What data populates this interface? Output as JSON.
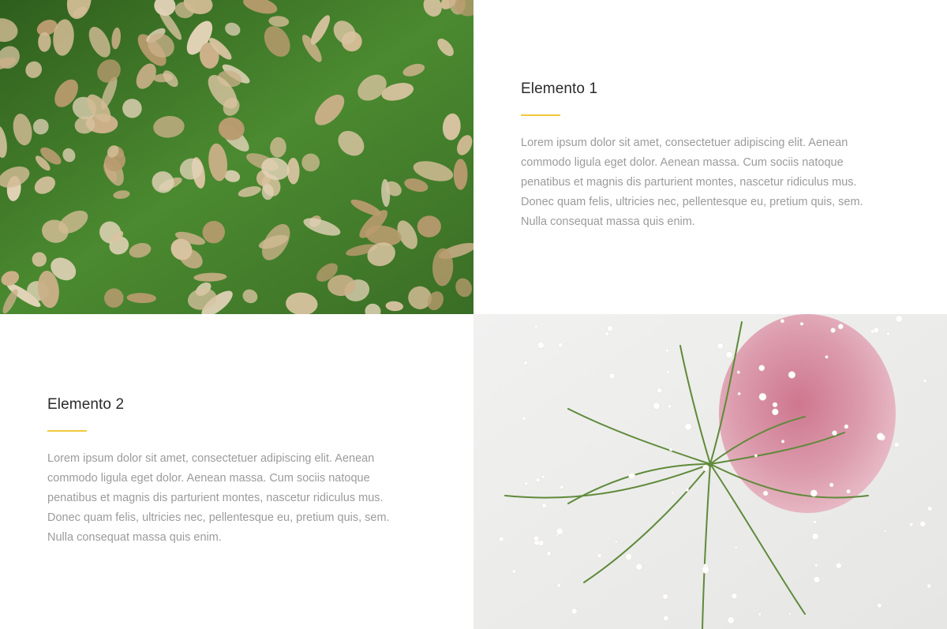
{
  "sections": [
    {
      "title": "Elemento 1",
      "body": "Lorem ipsum dolor sit amet, consectetuer adipiscing elit. Aenean commodo ligula eget dolor. Aenean massa. Cum sociis natoque penatibus et magnis dis parturient montes, nascetur ridiculus mus. Donec quam felis, ultricies nec, pellentesque eu, pretium quis, sem. Nulla consequat massa quis enim.",
      "image": "autumn-leaves-on-grass-photo"
    },
    {
      "title": "Elemento 2",
      "body": "Lorem ipsum dolor sit amet, consectetuer adipiscing elit. Aenean commodo ligula eget dolor. Aenean massa. Cum sociis natoque penatibus et magnis dis parturient montes, nascetur ridiculus mus. Donec quam felis, ultricies nec, pellentesque eu, pretium quis, sem. Nulla consequat massa quis enim.",
      "image": "white-wildflowers-pink-watercolor-photo"
    }
  ],
  "colors": {
    "accent": "#f1c93c",
    "title": "#2b2b2b",
    "body": "#9b9b9b",
    "grass": "#3f7a2a",
    "leaf": "#d9c2a0",
    "watercolor": "#d88ea0"
  }
}
